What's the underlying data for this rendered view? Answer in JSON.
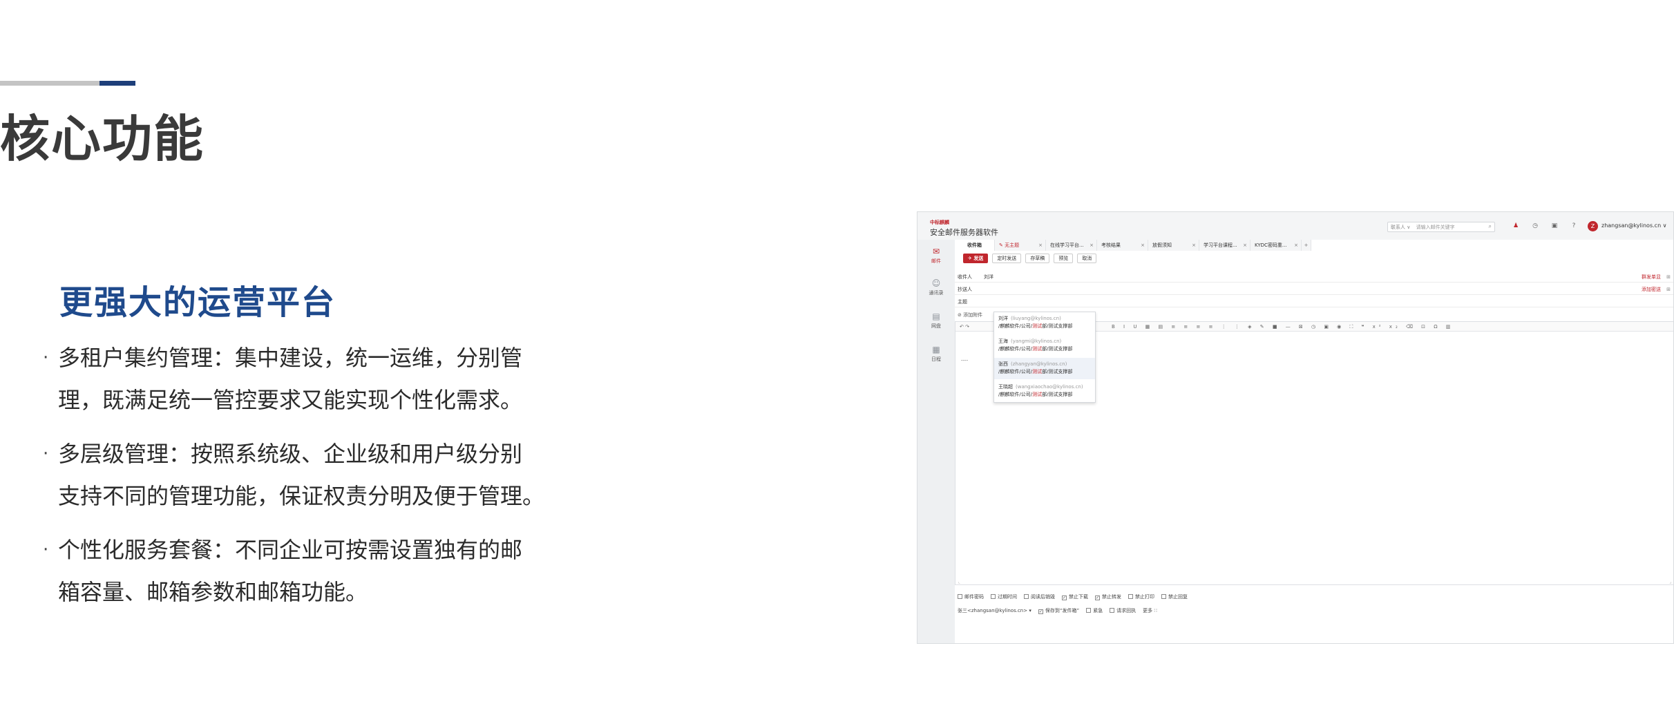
{
  "slide": {
    "title": "核心功能",
    "section_title": "更强大的运营平台",
    "bullet_mark": "·",
    "bullets": [
      {
        "line1": "多租户集约管理：集中建设，统一运维，分别管",
        "line2": "理，既满足统一管控要求又能实现个性化需求。"
      },
      {
        "line1": "多层级管理：按照系统级、企业级和用户级分别",
        "line2": "支持不同的管理功能，保证权责分明及便于管理。"
      },
      {
        "line1": "个性化服务套餐：不同企业可按需设置独有的邮",
        "line2": "箱容量、邮箱参数和邮箱功能。"
      }
    ],
    "colors": {
      "accent_blue": "#1f4a8c",
      "line_gray": "#c4c4c4",
      "line_blue": "#1e3f7a"
    }
  },
  "app": {
    "brand_logo": "中标麒麟",
    "brand_name": "安全邮件服务器软件",
    "search_select": "联系人 ∨",
    "search_placeholder": "请输入邮件关键字",
    "user_initial": "Z",
    "user_email": "zhangsan@kylinos.cn ∨",
    "icons": [
      "user-alert-icon",
      "clock-icon",
      "monitor-icon",
      "help-icon"
    ],
    "sidebar": [
      {
        "label": "邮件",
        "icon": "mail-icon",
        "active": true
      },
      {
        "label": "通讯录",
        "icon": "contacts-icon"
      },
      {
        "label": "网盘",
        "icon": "disk-icon"
      },
      {
        "label": "日程",
        "icon": "calendar-icon"
      }
    ],
    "tabs": [
      {
        "label": "收件箱"
      },
      {
        "label": "✎ 无主题"
      },
      {
        "label": "在线学习平台..."
      },
      {
        "label": "考核结果"
      },
      {
        "label": "放假须知"
      },
      {
        "label": "学习平台课程..."
      },
      {
        "label": "KYDC密码重..."
      }
    ],
    "toolbar": {
      "send": "✈ 发送",
      "scheduled": "定时发送",
      "draft": "存草稿",
      "preview": "预览",
      "cancel": "取消"
    },
    "fields": {
      "to_label": "收件人",
      "to_value": "刘洋",
      "to_right": "群发单显",
      "cc_label": "抄送人",
      "cc_right": "添加密送",
      "subject_label": "主题",
      "attach_label": "添加附件"
    },
    "dropdown": [
      {
        "name": "刘洋",
        "email": "(liuyang@kylinos.cn)",
        "path_a": "/麒麟软件/公司/",
        "path_hl": "测试",
        "path_b": "部/测试支撑部"
      },
      {
        "name": "王海",
        "email": "(yangmi@kylinos.cn)",
        "path_a": "/麒麟软件/公司/",
        "path_hl": "测试",
        "path_b": "部/测试支撑部"
      },
      {
        "name": "张西",
        "email": "(zhangyan@kylinos.cn)",
        "path_a": "/麒麟软件/公司/",
        "path_hl": "测试",
        "path_b": "部/测试支撑部"
      },
      {
        "name": "王晓超",
        "email": "(wangxiaochao@kylinos.cn)",
        "path_a": "/麒麟软件/公司/",
        "path_hl": "测试",
        "path_b": "部/测试支撑部"
      }
    ],
    "editor": {
      "signature": "----"
    },
    "options_row1": [
      {
        "label": "邮件密码",
        "checked": false
      },
      {
        "label": "过期时间",
        "checked": false
      },
      {
        "label": "阅读后销毁",
        "checked": false
      },
      {
        "label": "禁止下载",
        "checked": true
      },
      {
        "label": "禁止转发",
        "checked": true
      },
      {
        "label": "禁止打印",
        "checked": false
      },
      {
        "label": "禁止回复",
        "checked": false
      }
    ],
    "options_row2": {
      "sender": "张三<zhangsan@kylinos.cn> ▾",
      "save_sent": "保存到“发件箱”",
      "urgent": "紧急",
      "receipt": "请求回执",
      "more": "更多 ∷"
    },
    "colors": {
      "brand_red": "#c0262d"
    }
  }
}
